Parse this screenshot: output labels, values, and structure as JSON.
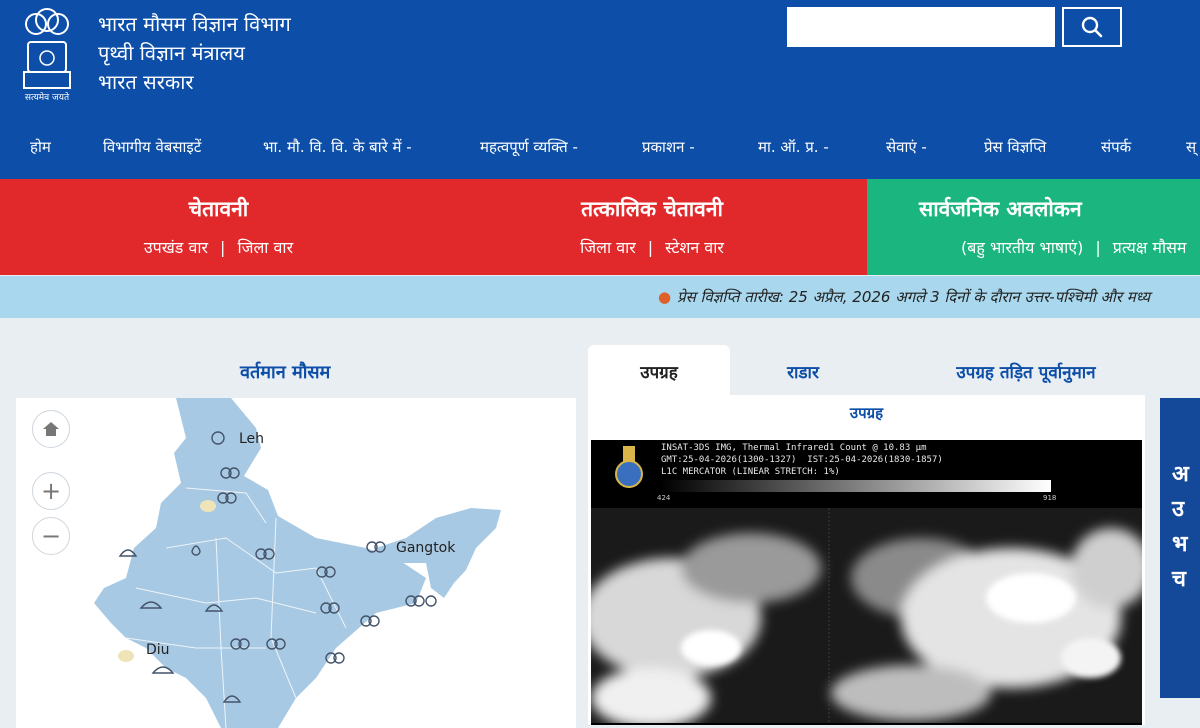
{
  "header": {
    "line1": "भारत मौसम विज्ञान विभाग",
    "line2": "पृथ्वी विज्ञान मंत्रालय",
    "line3": "भारत सरकार",
    "emblem_caption": "सत्यमेव जयते",
    "search_placeholder": ""
  },
  "nav": [
    {
      "label": "होम"
    },
    {
      "label": "विभागीय वेबसाइटें"
    },
    {
      "label": "भा. मौ. वि. वि. के बारे में -"
    },
    {
      "label": "महत्वपूर्ण व्यक्ति -"
    },
    {
      "label": "प्रकाशन -"
    },
    {
      "label": "मा. ऑ. प्र. -"
    },
    {
      "label": "सेवाएं -"
    },
    {
      "label": "प्रेस विज्ञप्ति"
    },
    {
      "label": "संपर्क"
    },
    {
      "label": "स्"
    }
  ],
  "alerts": [
    {
      "title": "चेतावनी",
      "link1": "उपखंड वार",
      "link2": "जिला वार"
    },
    {
      "title": "तत्कालिक चेतावनी",
      "link1": "जिला वार",
      "link2": "स्टेशन वार"
    },
    {
      "title": "सार्वजनिक अवलोकन",
      "link1": "(बहु भारतीय भाषाएं)",
      "link2": "प्रत्यक्ष मौसम"
    }
  ],
  "ticker": {
    "text": "प्रेस विज्ञप्ति तारीख: 25 अप्रैल, 2026 अगले 3 दिनों के दौरान उत्तर-पश्चिमी और मध्य"
  },
  "current_weather": {
    "title": "वर्तमान मौसम",
    "places": [
      "Leh",
      "Gangtok",
      "Diu"
    ]
  },
  "sat_tabs": [
    {
      "label": "उपग्रह",
      "active": true
    },
    {
      "label": "राडार",
      "active": false
    },
    {
      "label": "उपग्रह तड़ित पूर्वानुमान",
      "active": false
    }
  ],
  "satellite": {
    "caption": "उपग्रह",
    "header_line1": "INSAT-3DS IMG, Thermal Infrared1 Count @ 10.83 μm",
    "header_line2": "GMT:25-04-2026(1300-1327)  IST:25-04-2026(1830-1857)",
    "header_line3": "L1C MERCATOR (LINEAR STRETCH: 1%)",
    "scale_min": "424",
    "scale_max": "918"
  },
  "right_banner": {
    "letters": [
      "अ",
      "उ",
      "भ",
      "च"
    ]
  },
  "colors": {
    "header_blue": "#0d4fa8",
    "alert_red": "#e1292b",
    "alert_green": "#1bb57f",
    "ticker_bg": "#a9d8ee",
    "map_fill": "#a8c9e3"
  }
}
